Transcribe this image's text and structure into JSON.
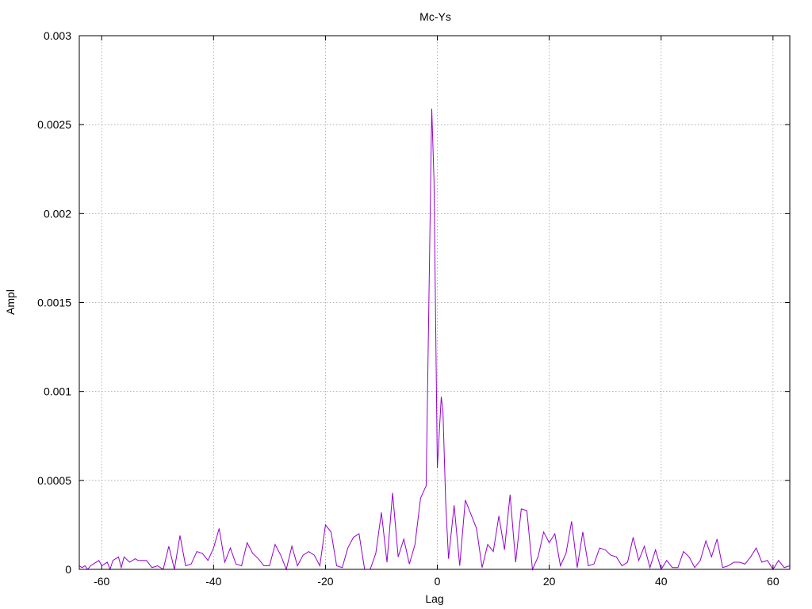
{
  "chart_data": {
    "type": "line",
    "title": "Mc-Ys",
    "xlabel": "Lag",
    "ylabel": "Ampl",
    "xlim": [
      -64,
      63
    ],
    "ylim": [
      0,
      0.003
    ],
    "x_ticks": [
      -60,
      -40,
      -20,
      0,
      20,
      40,
      60
    ],
    "y_ticks": [
      0,
      0.0005,
      0.001,
      0.0015,
      0.002,
      0.0025,
      0.003
    ],
    "y_tick_labels": [
      "0",
      "0.0005",
      "0.001",
      "0.0015",
      "0.002",
      "0.0025",
      "0.003"
    ],
    "grid": true,
    "legend": "none",
    "series": [
      {
        "color": "#9400d3",
        "points": [
          [
            -64,
            2e-05
          ],
          [
            -63.5,
            1e-05
          ],
          [
            -63,
            2e-05
          ],
          [
            -62.5,
            0.0
          ],
          [
            -62,
            2e-05
          ],
          [
            -61,
            4e-05
          ],
          [
            -60.5,
            5e-05
          ],
          [
            -60,
            2e-05
          ],
          [
            -59,
            4e-05
          ],
          [
            -58.5,
            0.0
          ],
          [
            -58,
            5e-05
          ],
          [
            -57,
            7e-05
          ],
          [
            -56.5,
            1e-05
          ],
          [
            -56,
            7e-05
          ],
          [
            -55,
            4e-05
          ],
          [
            -54,
            6e-05
          ],
          [
            -53.5,
            5e-05
          ],
          [
            -53,
            5e-05
          ],
          [
            -52,
            5e-05
          ],
          [
            -51,
            1e-05
          ],
          [
            -50,
            2e-05
          ],
          [
            -49,
            0.0
          ],
          [
            -48,
            0.00013
          ],
          [
            -47,
            0.0
          ],
          [
            -46,
            0.00019
          ],
          [
            -45,
            2e-05
          ],
          [
            -44,
            3e-05
          ],
          [
            -43,
            0.0001
          ],
          [
            -42,
            9e-05
          ],
          [
            -41,
            5e-05
          ],
          [
            -40,
            0.00012
          ],
          [
            -39,
            0.00023
          ],
          [
            -38,
            4e-05
          ],
          [
            -37,
            0.00012
          ],
          [
            -36,
            3e-05
          ],
          [
            -35,
            2e-05
          ],
          [
            -34,
            0.00015
          ],
          [
            -33,
            9e-05
          ],
          [
            -32,
            6e-05
          ],
          [
            -31,
            2e-05
          ],
          [
            -30,
            2e-05
          ],
          [
            -29,
            0.00014
          ],
          [
            -28,
            8e-05
          ],
          [
            -27,
            0.0
          ],
          [
            -26,
            0.00013
          ],
          [
            -25,
            2e-05
          ],
          [
            -24,
            8e-05
          ],
          [
            -23,
            0.0001
          ],
          [
            -22,
            8e-05
          ],
          [
            -21,
            2e-05
          ],
          [
            -20,
            0.00025
          ],
          [
            -19,
            0.00021
          ],
          [
            -18,
            2e-05
          ],
          [
            -17,
            1e-05
          ],
          [
            -16,
            0.00012
          ],
          [
            -15,
            0.00018
          ],
          [
            -14,
            0.0002
          ],
          [
            -13,
            0.0
          ],
          [
            -12,
            0.0
          ],
          [
            -11,
            9e-05
          ],
          [
            -10,
            0.00032
          ],
          [
            -9,
            4e-05
          ],
          [
            -8,
            0.00043
          ],
          [
            -7,
            7e-05
          ],
          [
            -6,
            0.00017
          ],
          [
            -5,
            3e-05
          ],
          [
            -4,
            0.00014
          ],
          [
            -3,
            0.0004
          ],
          [
            -2,
            0.00047
          ],
          [
            -1.5,
            0.00153
          ],
          [
            -1,
            0.00259
          ],
          [
            -0.6,
            0.00219
          ],
          [
            0,
            0.00057
          ],
          [
            0.7,
            0.00097
          ],
          [
            1,
            0.00089
          ],
          [
            1.5,
            0.00037
          ],
          [
            2,
            6e-05
          ],
          [
            3,
            0.00036
          ],
          [
            4,
            2e-05
          ],
          [
            5,
            0.00039
          ],
          [
            6,
            0.00031
          ],
          [
            7,
            0.00023
          ],
          [
            8,
            1e-05
          ],
          [
            9,
            0.00014
          ],
          [
            10,
            0.0001
          ],
          [
            11,
            0.0003
          ],
          [
            12,
            0.00011
          ],
          [
            13,
            0.00042
          ],
          [
            14,
            4e-05
          ],
          [
            15,
            0.00034
          ],
          [
            16,
            0.00033
          ],
          [
            17,
            0.0
          ],
          [
            18,
            7e-05
          ],
          [
            19,
            0.00021
          ],
          [
            20,
            0.00015
          ],
          [
            21,
            0.0002
          ],
          [
            22,
            2e-05
          ],
          [
            23,
            9e-05
          ],
          [
            24,
            0.00027
          ],
          [
            25,
            1e-05
          ],
          [
            26,
            0.00021
          ],
          [
            27,
            2e-05
          ],
          [
            28,
            3e-05
          ],
          [
            29,
            0.00012
          ],
          [
            30,
            0.00011
          ],
          [
            31,
            8e-05
          ],
          [
            32,
            7e-05
          ],
          [
            33,
            2e-05
          ],
          [
            34,
            4e-05
          ],
          [
            35,
            0.00018
          ],
          [
            36,
            5e-05
          ],
          [
            37,
            0.00013
          ],
          [
            38,
            1e-05
          ],
          [
            39,
            0.00011
          ],
          [
            40,
            0.0
          ],
          [
            41,
            5e-05
          ],
          [
            42,
            1e-05
          ],
          [
            43,
            1e-05
          ],
          [
            44,
            0.0001
          ],
          [
            45,
            7e-05
          ],
          [
            46,
            1e-05
          ],
          [
            47,
            5e-05
          ],
          [
            48,
            0.00016
          ],
          [
            49,
            7e-05
          ],
          [
            50,
            0.00017
          ],
          [
            51,
            1e-05
          ],
          [
            52,
            2e-05
          ],
          [
            53,
            4e-05
          ],
          [
            54,
            4e-05
          ],
          [
            55,
            3e-05
          ],
          [
            56,
            7e-05
          ],
          [
            57,
            0.00012
          ],
          [
            58,
            4e-05
          ],
          [
            59,
            5e-05
          ],
          [
            60,
            0.0
          ],
          [
            61,
            5e-05
          ],
          [
            62,
            1e-05
          ],
          [
            63,
            2e-05
          ]
        ]
      }
    ]
  }
}
